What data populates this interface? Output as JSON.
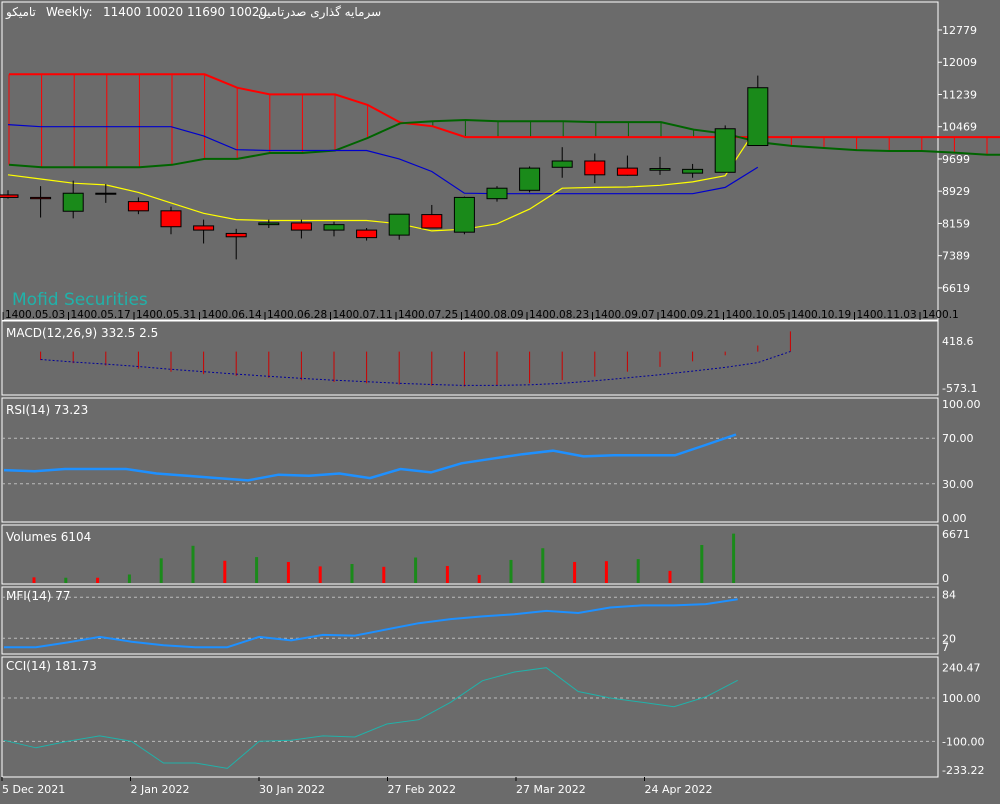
{
  "header": {
    "symbol": "تامیکو",
    "timeframe": "Weekly",
    "ohlc": "11400 10020 11690 10020",
    "company": "سرمایه گذاری صدرتامین"
  },
  "watermark": "Mofid Securities",
  "colors": {
    "background": "#6b6b6b",
    "bull": "#1a8a1a",
    "bear": "#ff0000",
    "kijun": "#0000cc",
    "tenkan": "#ffff00",
    "senkou_a": "#006400",
    "senkou_b": "#ff0000",
    "macd_hist": "#cc0000",
    "macd_signal": "#000099",
    "rsi": "#1e90ff",
    "mfi": "#1e90ff",
    "cci": "#20b2aa",
    "grid_text": "#ffffff"
  },
  "chart_data": [
    {
      "type": "candlestick",
      "panel": "price",
      "ylim": [
        5900,
        13400
      ],
      "y_ticks": [
        12779,
        12009,
        11239,
        10469,
        9699,
        8929,
        8159,
        7389,
        6619
      ],
      "x_period_labels": [
        "1400.05.03",
        "1400.05.17",
        "1400.05.31",
        "1400.06.14",
        "1400.06.28",
        "1400.07.11",
        "1400.07.25",
        "1400.08.09",
        "1400.08.23",
        "1400.09.07",
        "1400.09.21",
        "1400.10.05",
        "1400.10.19",
        "1400.11.03",
        "1400.1"
      ],
      "candles": [
        {
          "o": 8840,
          "h": 8950,
          "l": 8750,
          "c": 8780
        },
        {
          "o": 8780,
          "h": 9050,
          "l": 8300,
          "c": 8750
        },
        {
          "o": 8450,
          "h": 9180,
          "l": 8280,
          "c": 8880
        },
        {
          "o": 8880,
          "h": 9100,
          "l": 8650,
          "c": 8860
        },
        {
          "o": 8680,
          "h": 8780,
          "l": 8380,
          "c": 8460
        },
        {
          "o": 8460,
          "h": 8560,
          "l": 7900,
          "c": 8080
        },
        {
          "o": 8100,
          "h": 8250,
          "l": 7680,
          "c": 8000
        },
        {
          "o": 7920,
          "h": 8030,
          "l": 7300,
          "c": 7840
        },
        {
          "o": 8130,
          "h": 8250,
          "l": 8050,
          "c": 8170
        },
        {
          "o": 8170,
          "h": 8250,
          "l": 7800,
          "c": 8000
        },
        {
          "o": 8000,
          "h": 8200,
          "l": 7850,
          "c": 8130
        },
        {
          "o": 8000,
          "h": 8050,
          "l": 7750,
          "c": 7820
        },
        {
          "o": 7880,
          "h": 8380,
          "l": 7770,
          "c": 8380
        },
        {
          "o": 8370,
          "h": 8600,
          "l": 8050,
          "c": 8050
        },
        {
          "o": 7950,
          "h": 8800,
          "l": 7900,
          "c": 8780
        },
        {
          "o": 8750,
          "h": 9050,
          "l": 8680,
          "c": 9000
        },
        {
          "o": 8950,
          "h": 9520,
          "l": 8900,
          "c": 9480
        },
        {
          "o": 9500,
          "h": 9980,
          "l": 9250,
          "c": 9650
        },
        {
          "o": 9650,
          "h": 9830,
          "l": 9120,
          "c": 9320
        },
        {
          "o": 9480,
          "h": 9780,
          "l": 9300,
          "c": 9310
        },
        {
          "o": 9430,
          "h": 9750,
          "l": 9320,
          "c": 9470
        },
        {
          "o": 9360,
          "h": 9580,
          "l": 9250,
          "c": 9450
        },
        {
          "o": 9380,
          "h": 10500,
          "l": 9380,
          "c": 10420
        },
        {
          "o": 10020,
          "h": 11690,
          "l": 10020,
          "c": 11400
        }
      ],
      "tenkan": [
        9320,
        9220,
        9120,
        9080,
        8900,
        8650,
        8400,
        8250,
        8230,
        8230,
        8230,
        8230,
        8150,
        7980,
        8020,
        8150,
        8500,
        9000,
        9020,
        9030,
        9070,
        9150,
        9300,
        10480
      ],
      "kijun": [
        10520,
        10470,
        10470,
        10470,
        10470,
        10470,
        10250,
        9920,
        9900,
        9900,
        9900,
        9900,
        9700,
        9400,
        8880,
        8870,
        8870,
        8870,
        8870,
        8870,
        8870,
        8870,
        9020,
        9500
      ],
      "senkou_a": [
        9560,
        9500,
        9500,
        9500,
        9500,
        9560,
        9700,
        9700,
        9840,
        9840,
        9900,
        10200,
        10550,
        10600,
        10630,
        10600,
        10600,
        10600,
        10580,
        10580,
        10580,
        10400,
        10300,
        10100,
        10010,
        9960,
        9910,
        9890,
        9890,
        9850,
        9800,
        9800
      ],
      "senkou_b": [
        11720,
        11720,
        11720,
        11720,
        11720,
        11720,
        11720,
        11400,
        11240,
        11240,
        11240,
        10990,
        10570,
        10480,
        10220,
        10220,
        10220,
        10220,
        10220,
        10220,
        10220,
        10220,
        10220,
        10220,
        10220,
        10220,
        10220,
        10220,
        10220,
        10220,
        10220,
        10220
      ]
    },
    {
      "type": "bar",
      "panel": "macd",
      "label": "MACD(12,26,9) 332.5 2.5",
      "ylim": [
        -680,
        470
      ],
      "y_ticks": [
        418.6,
        -573.1
      ],
      "histogram": [
        -140,
        -190,
        -230,
        -280,
        -330,
        -370,
        -400,
        -430,
        -470,
        -500,
        -520,
        -540,
        -560,
        -575,
        -560,
        -520,
        -470,
        -410,
        -330,
        -250,
        -160,
        -60,
        100,
        332.5
      ],
      "signal": [
        -130,
        -170,
        -205,
        -245,
        -290,
        -330,
        -370,
        -405,
        -440,
        -470,
        -495,
        -520,
        -540,
        -555,
        -555,
        -545,
        -520,
        -480,
        -430,
        -380,
        -320,
        -260,
        -180,
        2.5
      ]
    },
    {
      "type": "line",
      "panel": "rsi",
      "label": "RSI(14) 73.23",
      "ylim": [
        0,
        100
      ],
      "y_ticks": [
        "100.00",
        "70.00",
        "30.00",
        "0.00"
      ],
      "levels": [
        70,
        30
      ],
      "values": [
        42,
        41,
        43,
        43,
        43,
        39,
        37,
        35,
        33,
        38,
        37,
        39,
        35,
        43,
        40,
        48,
        52,
        56,
        59,
        54,
        55,
        55,
        55,
        64,
        73.23
      ]
    },
    {
      "type": "bar",
      "panel": "volume",
      "label": "Volumes 6104",
      "ylim": [
        0,
        6800
      ],
      "y_ticks": [
        6671,
        0
      ],
      "values": [
        700,
        650,
        650,
        1050,
        3050,
        4600,
        2750,
        3200,
        2600,
        2050,
        2350,
        2000,
        3150,
        2100,
        1000,
        2850,
        4300,
        2600,
        2700,
        2950,
        1500,
        4700,
        6104
      ],
      "directions": [
        "down",
        "up",
        "down",
        "up",
        "up",
        "up",
        "down",
        "up",
        "down",
        "down",
        "up",
        "down",
        "up",
        "down",
        "down",
        "up",
        "up",
        "down",
        "down",
        "up",
        "down",
        "up",
        "up"
      ]
    },
    {
      "type": "line",
      "panel": "mfi",
      "label": "MFI(14) 77",
      "ylim": [
        0,
        92
      ],
      "y_ticks": [
        "84",
        "20",
        "7"
      ],
      "levels": [
        80,
        20
      ],
      "values": [
        7,
        7,
        14,
        22,
        15,
        10,
        7,
        7,
        22,
        17,
        25,
        24,
        33,
        42,
        48,
        52,
        55,
        60,
        57,
        65,
        68,
        68,
        70,
        77
      ]
    },
    {
      "type": "line",
      "panel": "cci",
      "label": "CCI(14) 181.73",
      "ylim": [
        -260,
        280
      ],
      "y_ticks": [
        "240.47",
        "100.00",
        "-100.00",
        "-233.22"
      ],
      "levels": [
        100,
        -100
      ],
      "values": [
        -95,
        -130,
        -100,
        -75,
        -100,
        -200,
        -200,
        -225,
        -100,
        -95,
        -75,
        -80,
        -20,
        0,
        80,
        180,
        220,
        240,
        130,
        100,
        80,
        60,
        105,
        181.73
      ]
    }
  ],
  "x_axis": {
    "dates": [
      "5 Dec 2021",
      "2 Jan 2022",
      "30 Jan 2022",
      "27 Feb 2022",
      "27 Mar 2022",
      "24 Apr 2022"
    ]
  }
}
